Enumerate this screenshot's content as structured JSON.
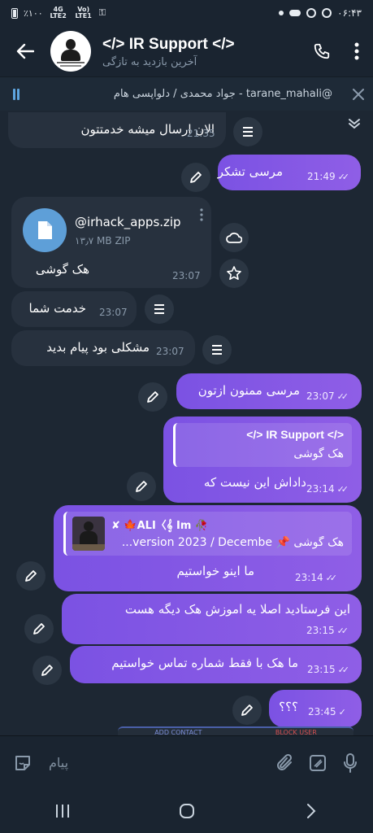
{
  "status_bar": {
    "battery": "٪۱۰۰",
    "network_1": "4G LTE2",
    "network_2": "Vo) LTE1",
    "time": "۰۶:۴۳"
  },
  "header": {
    "title": "</> IR Support </>",
    "subtitle": "آخرین بازدید به تازگی"
  },
  "pinned": {
    "text": "جواد محمدی / دلواپسی هام - tarane_mahali@"
  },
  "messages": [
    {
      "dir": "in",
      "text": "الان ارسال میشه خدمتتون",
      "time": "21:35"
    },
    {
      "dir": "out",
      "text": "مرسی تشکر",
      "time": "21:49"
    },
    {
      "dir": "in",
      "file_name": "@irhack_apps.zip",
      "file_size": "۱۳٫۷ MB ZIP",
      "text": "هک گوشی",
      "time": "23:07"
    },
    {
      "dir": "in",
      "text": "خدمت شما",
      "time": "23:07"
    },
    {
      "dir": "in",
      "text": "مشکلی بود پیام بدید",
      "time": "23:07"
    },
    {
      "dir": "out",
      "text": "مرسی ممنون ازتون",
      "time": "23:07"
    },
    {
      "dir": "out",
      "reply_name": "</> IR Support </>",
      "reply_text": "هک گوشی",
      "text": "داداش این نیست که",
      "time": "23:14"
    },
    {
      "dir": "out",
      "reply_name": "✘ 🍁ALI〈𝄞 Im 🥀",
      "reply_text": "هک گوشی 📌 version 2023 / Decembe...",
      "text": "ما اینو خواستیم",
      "time": "23:14"
    },
    {
      "dir": "out",
      "text": "این فرستادید اصلا یه اموزش هک دیگه هست",
      "time": "23:15"
    },
    {
      "dir": "out",
      "text": "ما هک با فقط شماره تماس خواستیم",
      "time": "23:15"
    },
    {
      "dir": "out",
      "text": "؟؟؟",
      "time": "23:45"
    }
  ],
  "ad_strip": {
    "left": "ADD CONTACT",
    "right": "BLOCK USER"
  },
  "input": {
    "placeholder": "پیام"
  },
  "colors": {
    "out_bubble": "#7b52e3",
    "in_bubble": "#27313e",
    "background": "#1d2733",
    "accent": "#5ea5e0"
  }
}
